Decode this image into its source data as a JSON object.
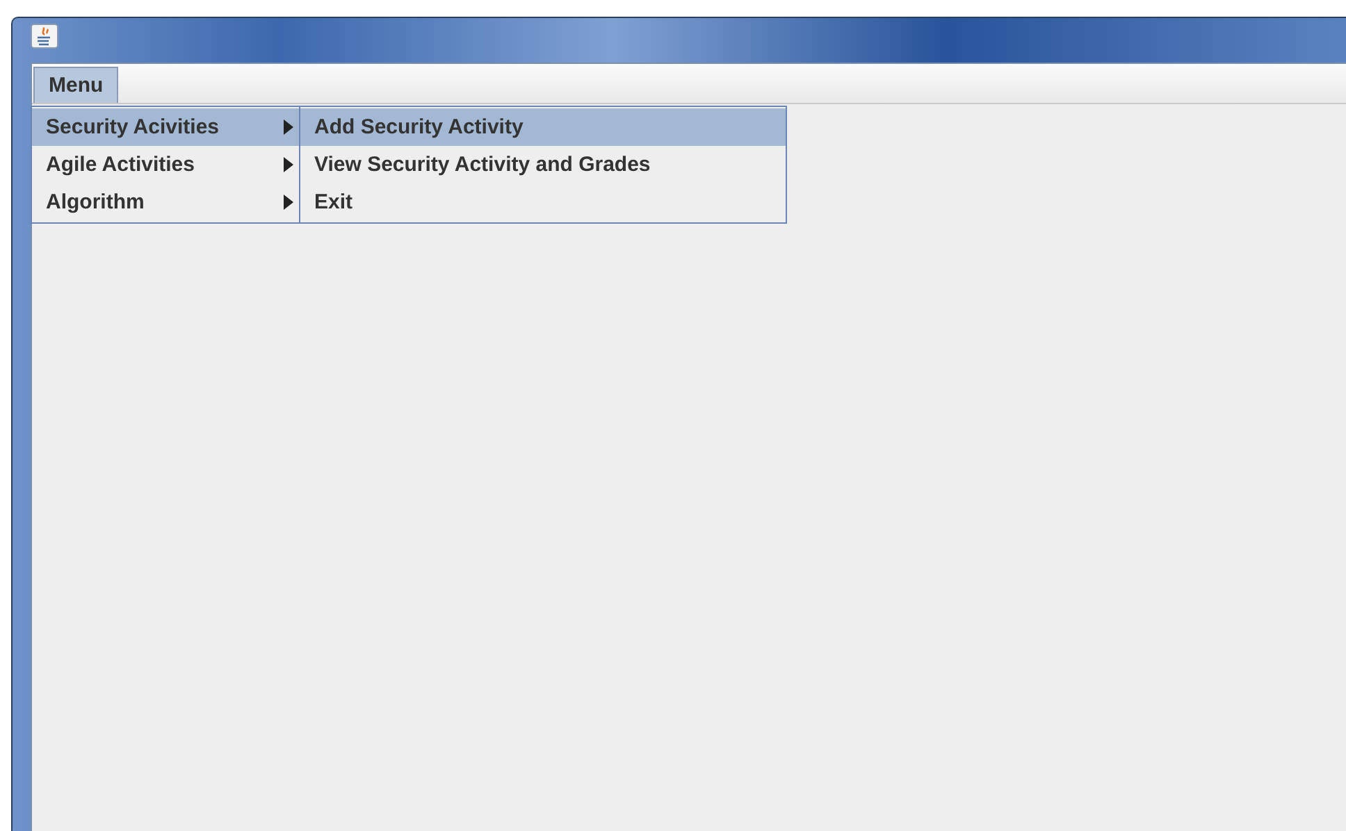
{
  "menu_bar": {
    "menus": [
      {
        "label": "Menu",
        "selected": true
      }
    ]
  },
  "dropdown": {
    "items": [
      {
        "label": "Security Acivities",
        "selected": true,
        "has_submenu": true
      },
      {
        "label": "Agile Activities",
        "selected": false,
        "has_submenu": true
      },
      {
        "label": "Algorithm",
        "selected": false,
        "has_submenu": true
      }
    ]
  },
  "submenu": {
    "items": [
      {
        "label": "Add Security Activity",
        "selected": true
      },
      {
        "label": "View Security Activity and Grades",
        "selected": false
      },
      {
        "label": "Exit",
        "selected": false
      }
    ]
  }
}
